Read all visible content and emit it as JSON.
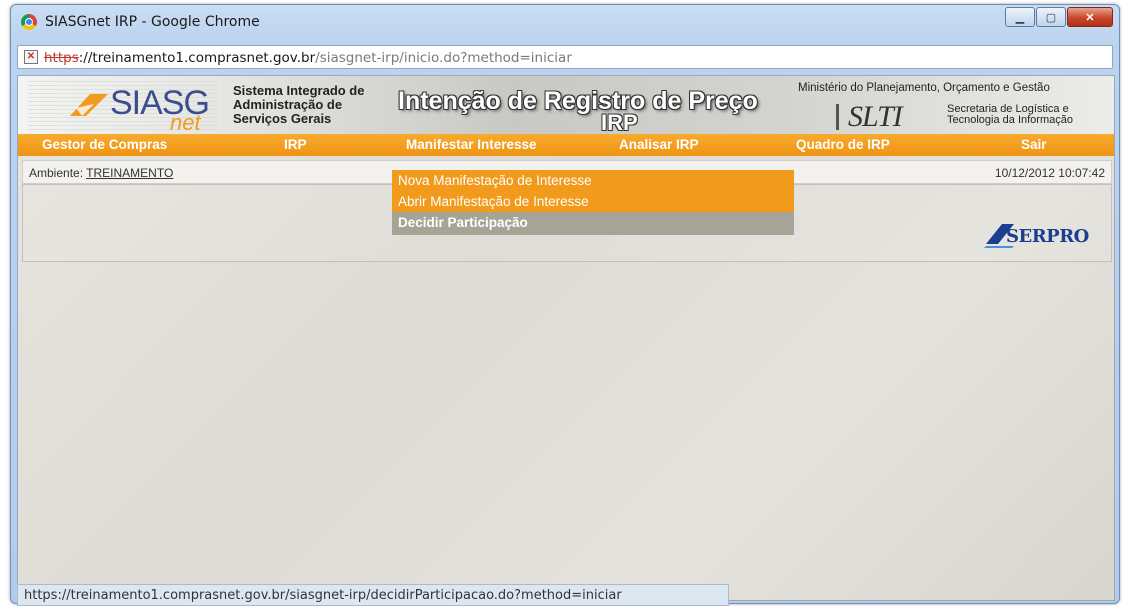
{
  "window": {
    "title": "SIASGnet IRP - Google Chrome"
  },
  "address_bar": {
    "scheme": "https",
    "host_part": "://treinamento1.comprasnet.gov.br",
    "path_part": "/siasgnet-irp/inicio.do?method=iniciar"
  },
  "banner": {
    "logo_main": "SIASG",
    "logo_sub": "net",
    "system_line1": "Sistema Integrado de",
    "system_line2": "Administração de",
    "system_line3": "Serviços Gerais",
    "title": "Intenção de Registro de Preço",
    "subtitle": "IRP",
    "ministry": "Ministério do Planejamento, Orçamento e Gestão",
    "slti": "SLTI",
    "slti_line1": "Secretaria de Logística e",
    "slti_line2": "Tecnologia da Informação"
  },
  "menu": {
    "items": [
      "Gestor de Compras",
      "IRP",
      "Manifestar Interesse",
      "Analisar IRP",
      "Quadro de IRP",
      "Sair"
    ]
  },
  "dropdown": {
    "items": [
      "Nova Manifestação de Interesse",
      "Abrir Manifestação de Interesse",
      "Decidir Participação"
    ],
    "hovered": "Decidir Participação"
  },
  "info": {
    "ambiente_label": "Ambiente: ",
    "ambiente_value": "TREINAMENTO",
    "timestamp": "10/12/2012 10:07:42"
  },
  "serpro": {
    "text": "SERPRO"
  },
  "status_bar": {
    "url": "https://treinamento1.comprasnet.gov.br/siasgnet-irp/decidirParticipacao.do?method=iniciar"
  },
  "colors": {
    "menu_orange": "#f29a1c",
    "hover_gray": "#a6a497",
    "serpro_blue": "#1b3f8e"
  }
}
